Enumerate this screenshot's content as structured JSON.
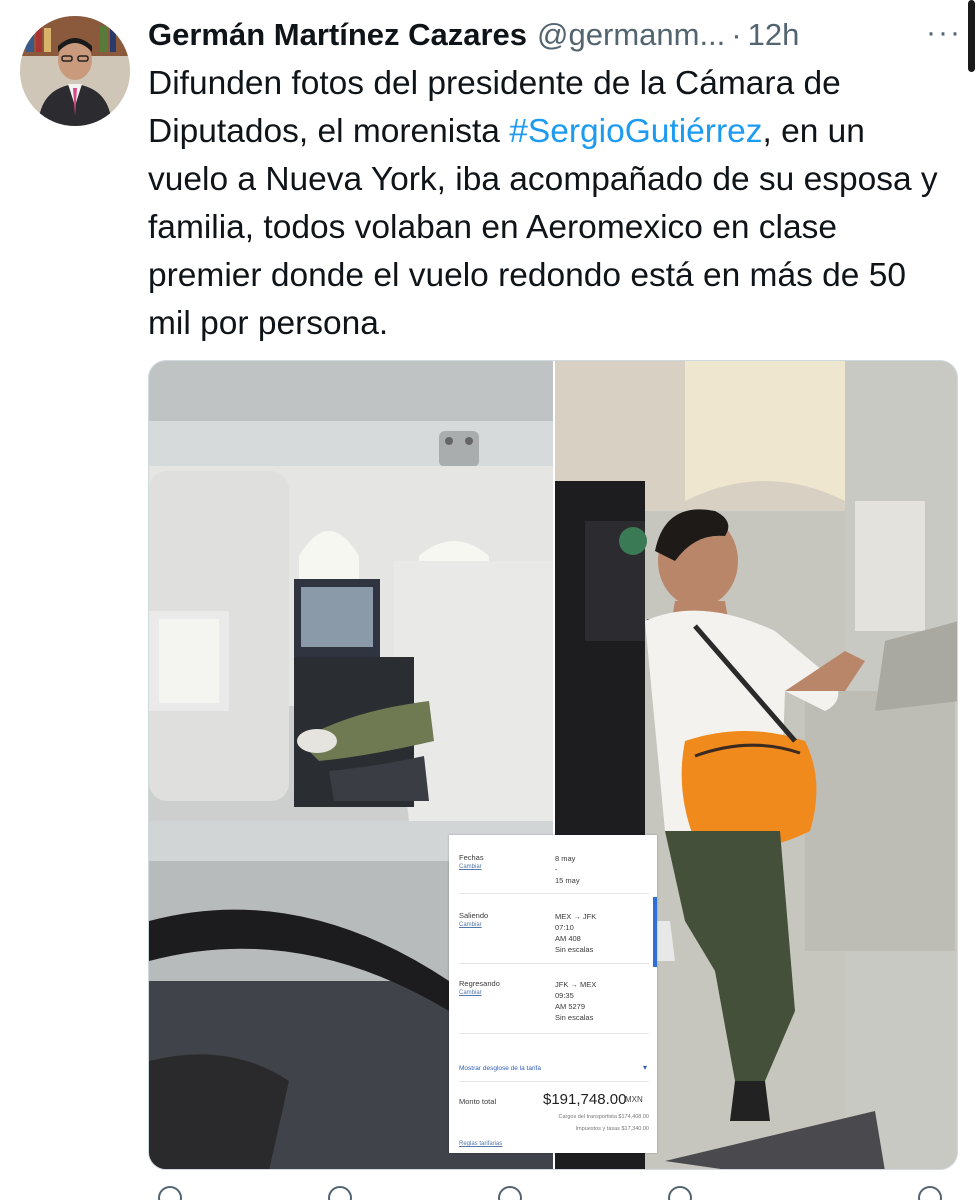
{
  "author": {
    "name": "Germán Martínez Cazares",
    "handle": "@germanm...",
    "separator": "·",
    "time": "12h",
    "more_icon": "more-horizontal-icon"
  },
  "tweet": {
    "text_before": "Difunden fotos del presidente de la Cámara de Diputados, el morenista ",
    "hashtag": "#SergioGutiérrez",
    "text_after": ", en un vuelo a Nueva York, iba acompañado de su esposa y familia, todos volaban en Aeromexico en clase premier donde el vuelo redondo está en más de 50 mil por persona."
  },
  "receipt": {
    "fechas_label": "Fechas",
    "fechas_change": "Cambiar",
    "fechas_start": "8 may",
    "fechas_dash": "-",
    "fechas_end": "15 may",
    "saliendo_label": "Saliendo",
    "saliendo_change": "Cambiar",
    "saliendo_route": "MEX → JFK",
    "saliendo_time": "07:10",
    "saliendo_flight": "AM 408",
    "saliendo_stops": "Sin escalas",
    "regresando_label": "Regresando",
    "regresando_change": "Cambiar",
    "regresando_route": "JFK → MEX",
    "regresando_time": "09:35",
    "regresando_flight": "AM 5279",
    "regresando_stops": "Sin escalas",
    "desglose": "Mostrar desglose de la tarifa",
    "chevron": "▾",
    "total_label": "Monto total",
    "total_value": "$191,748.00",
    "total_currency": "MXN",
    "cargos": "Cargos del transportista $174,408.00",
    "impuestos": "Impuestos y tasas $17,340.00",
    "reglas": "Reglas tarifarias"
  },
  "colors": {
    "link": "#1d9bf0",
    "text": "#0f1419",
    "muted": "#536471",
    "backpack": "#f08a1c"
  }
}
